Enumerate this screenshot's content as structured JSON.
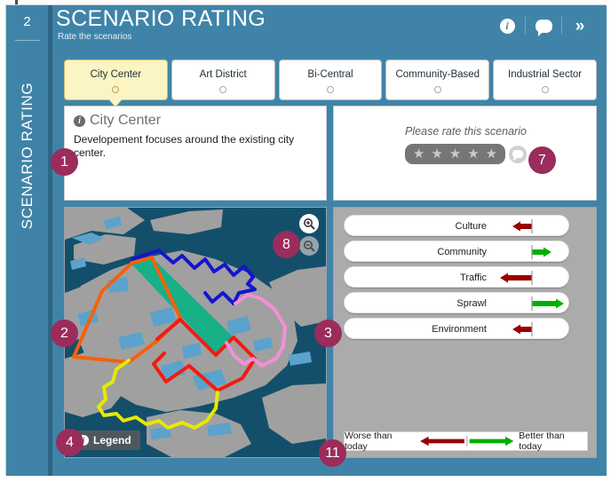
{
  "rail": {
    "step_number": "2",
    "title": "SCENARIO RATING"
  },
  "header": {
    "title": "SCENARIO RATING",
    "subtitle": "Rate the scenarios",
    "icons": {
      "info": "info-icon",
      "comment": "comment-icon",
      "expand": "»"
    }
  },
  "tabs": [
    {
      "label": "City Center",
      "active": true
    },
    {
      "label": "Art District",
      "active": false
    },
    {
      "label": "Bi-Central",
      "active": false
    },
    {
      "label": "Community-Based",
      "active": false
    },
    {
      "label": "Industrial Sector",
      "active": false
    }
  ],
  "info_panel": {
    "title": "City Center",
    "description": "Developement focuses around the existing city center."
  },
  "rating_panel": {
    "prompt": "Please rate this scenario",
    "stars": [
      "★",
      "★",
      "★",
      "★",
      "★"
    ],
    "stars_selected": 0,
    "comment_icon": "comment-icon"
  },
  "map": {
    "legend_label": "Legend",
    "zoom_in": "zoom-in-icon",
    "zoom_out": "zoom-out-icon",
    "water_color": "#134f6b",
    "land_color": "#a0a0a0",
    "shallow_color": "#5ba3cc",
    "districts": [
      {
        "name": "blue-district",
        "color": "#1414d2"
      },
      {
        "name": "orange-district",
        "color": "#f4610c"
      },
      {
        "name": "red-district",
        "color": "#f21b10"
      },
      {
        "name": "yellow-district",
        "color": "#e8e800"
      },
      {
        "name": "pink-district",
        "color": "#f58fd8"
      },
      {
        "name": "teal-corridor",
        "color": "#17b089"
      }
    ]
  },
  "indicators": [
    {
      "label": "Culture",
      "direction": "worse",
      "magnitude": 1,
      "color": "#990000"
    },
    {
      "label": "Community",
      "direction": "better",
      "magnitude": 1,
      "color": "#00b000"
    },
    {
      "label": "Traffic",
      "direction": "worse",
      "magnitude": 2,
      "color": "#990000"
    },
    {
      "label": "Sprawl",
      "direction": "better",
      "magnitude": 2,
      "color": "#00b000"
    },
    {
      "label": "Environment",
      "direction": "worse",
      "magnitude": 1,
      "color": "#990000"
    }
  ],
  "indicator_legend": {
    "left_label": "Worse than today",
    "right_label": "Better than today",
    "worse_color": "#990000",
    "better_color": "#00b000"
  },
  "markers": {
    "m1": "1",
    "m2": "2",
    "m3": "3",
    "m4": "4",
    "m7": "7",
    "m8": "8",
    "m11": "11",
    "color": "#9b2c5b"
  }
}
